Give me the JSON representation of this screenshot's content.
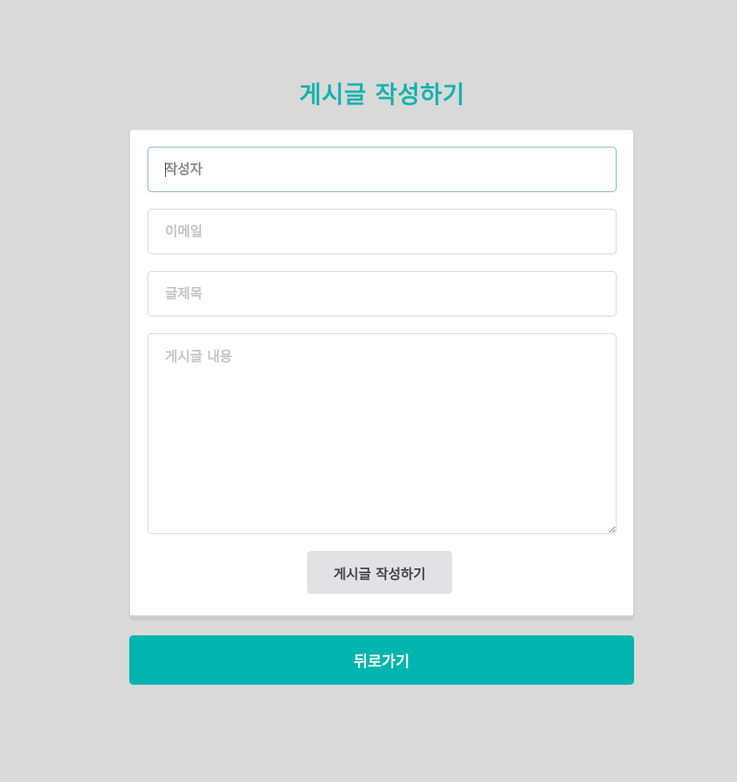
{
  "page": {
    "title": "게시글 작성하기"
  },
  "form": {
    "author": {
      "placeholder": "작성자",
      "value": ""
    },
    "email": {
      "placeholder": "이메일",
      "value": ""
    },
    "subject": {
      "placeholder": "글제목",
      "value": ""
    },
    "content": {
      "placeholder": "게시글 내용",
      "value": ""
    },
    "submit_label": "게시글 작성하기"
  },
  "actions": {
    "back_label": "뒤로가기"
  },
  "colors": {
    "accent": "#00b5af",
    "title": "#14b3ad",
    "background": "#d9d9d9",
    "submit_bg": "#e1e2e6"
  }
}
